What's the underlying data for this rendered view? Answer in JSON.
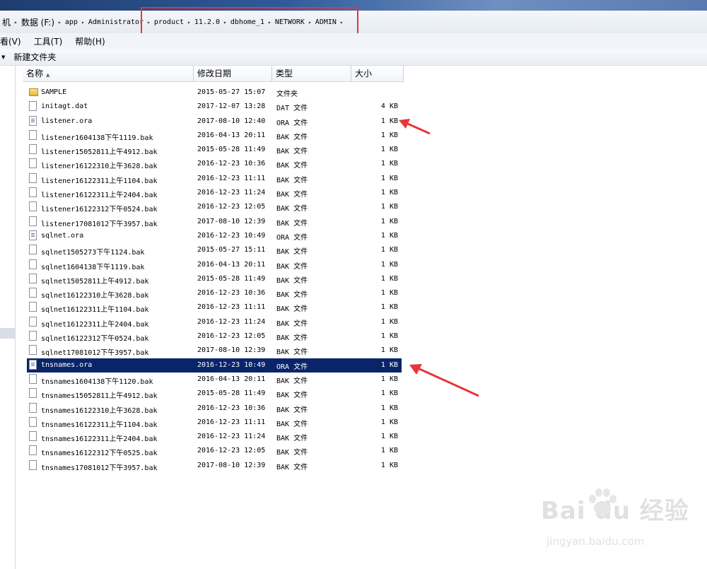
{
  "address": {
    "crumbs": [
      "机",
      "数据 (F:)",
      "app",
      "Administrator",
      "product",
      "11.2.0",
      "dbhome_1",
      "NETWORK",
      "ADMIN"
    ]
  },
  "menu": {
    "items": [
      "看(V)",
      "工具(T)",
      "帮助(H)"
    ]
  },
  "toolbar": {
    "new_folder": "新建文件夹"
  },
  "columns": {
    "name": "名称",
    "date": "修改日期",
    "type": "类型",
    "size": "大小"
  },
  "files": [
    {
      "name": "SAMPLE",
      "date": "2015-05-27 15:07",
      "type": "文件夹",
      "size": "",
      "icon": "folder-icon",
      "kind": "folder"
    },
    {
      "name": "initagt.dat",
      "date": "2017-12-07 13:28",
      "type": "DAT 文件",
      "size": "4 KB",
      "icon": "file-icon",
      "kind": "file"
    },
    {
      "name": "listener.ora",
      "date": "2017-08-10 12:40",
      "type": "ORA 文件",
      "size": "1 KB",
      "icon": "ora-file-icon",
      "kind": "ora"
    },
    {
      "name": "listener1604138下午1119.bak",
      "date": "2016-04-13 20:11",
      "type": "BAK 文件",
      "size": "1 KB",
      "icon": "file-icon",
      "kind": "file"
    },
    {
      "name": "listener15052811上午4912.bak",
      "date": "2015-05-28 11:49",
      "type": "BAK 文件",
      "size": "1 KB",
      "icon": "file-icon",
      "kind": "file"
    },
    {
      "name": "listener16122310上午3628.bak",
      "date": "2016-12-23 10:36",
      "type": "BAK 文件",
      "size": "1 KB",
      "icon": "file-icon",
      "kind": "file"
    },
    {
      "name": "listener16122311上午1104.bak",
      "date": "2016-12-23 11:11",
      "type": "BAK 文件",
      "size": "1 KB",
      "icon": "file-icon",
      "kind": "file"
    },
    {
      "name": "listener16122311上午2404.bak",
      "date": "2016-12-23 11:24",
      "type": "BAK 文件",
      "size": "1 KB",
      "icon": "file-icon",
      "kind": "file"
    },
    {
      "name": "listener16122312下午0524.bak",
      "date": "2016-12-23 12:05",
      "type": "BAK 文件",
      "size": "1 KB",
      "icon": "file-icon",
      "kind": "file"
    },
    {
      "name": "listener17081012下午3957.bak",
      "date": "2017-08-10 12:39",
      "type": "BAK 文件",
      "size": "1 KB",
      "icon": "file-icon",
      "kind": "file"
    },
    {
      "name": "sqlnet.ora",
      "date": "2016-12-23 10:49",
      "type": "ORA 文件",
      "size": "1 KB",
      "icon": "ora-file-icon",
      "kind": "ora"
    },
    {
      "name": "sqlnet1505273下午1124.bak",
      "date": "2015-05-27 15:11",
      "type": "BAK 文件",
      "size": "1 KB",
      "icon": "file-icon",
      "kind": "file"
    },
    {
      "name": "sqlnet1604138下午1119.bak",
      "date": "2016-04-13 20:11",
      "type": "BAK 文件",
      "size": "1 KB",
      "icon": "file-icon",
      "kind": "file"
    },
    {
      "name": "sqlnet15052811上午4912.bak",
      "date": "2015-05-28 11:49",
      "type": "BAK 文件",
      "size": "1 KB",
      "icon": "file-icon",
      "kind": "file"
    },
    {
      "name": "sqlnet16122310上午3628.bak",
      "date": "2016-12-23 10:36",
      "type": "BAK 文件",
      "size": "1 KB",
      "icon": "file-icon",
      "kind": "file"
    },
    {
      "name": "sqlnet16122311上午1104.bak",
      "date": "2016-12-23 11:11",
      "type": "BAK 文件",
      "size": "1 KB",
      "icon": "file-icon",
      "kind": "file"
    },
    {
      "name": "sqlnet16122311上午2404.bak",
      "date": "2016-12-23 11:24",
      "type": "BAK 文件",
      "size": "1 KB",
      "icon": "file-icon",
      "kind": "file"
    },
    {
      "name": "sqlnet16122312下午0524.bak",
      "date": "2016-12-23 12:05",
      "type": "BAK 文件",
      "size": "1 KB",
      "icon": "file-icon",
      "kind": "file"
    },
    {
      "name": "sqlnet17081012下午3957.bak",
      "date": "2017-08-10 12:39",
      "type": "BAK 文件",
      "size": "1 KB",
      "icon": "file-icon",
      "kind": "file"
    },
    {
      "name": "tnsnames.ora",
      "date": "2016-12-23 10:49",
      "type": "ORA 文件",
      "size": "1 KB",
      "icon": "ora-file-icon",
      "kind": "ora",
      "selected": true
    },
    {
      "name": "tnsnames1604138下午1120.bak",
      "date": "2016-04-13 20:11",
      "type": "BAK 文件",
      "size": "1 KB",
      "icon": "file-icon",
      "kind": "file"
    },
    {
      "name": "tnsnames15052811上午4912.bak",
      "date": "2015-05-28 11:49",
      "type": "BAK 文件",
      "size": "1 KB",
      "icon": "file-icon",
      "kind": "file"
    },
    {
      "name": "tnsnames16122310上午3628.bak",
      "date": "2016-12-23 10:36",
      "type": "BAK 文件",
      "size": "1 KB",
      "icon": "file-icon",
      "kind": "file"
    },
    {
      "name": "tnsnames16122311上午1104.bak",
      "date": "2016-12-23 11:11",
      "type": "BAK 文件",
      "size": "1 KB",
      "icon": "file-icon",
      "kind": "file"
    },
    {
      "name": "tnsnames16122311上午2404.bak",
      "date": "2016-12-23 11:24",
      "type": "BAK 文件",
      "size": "1 KB",
      "icon": "file-icon",
      "kind": "file"
    },
    {
      "name": "tnsnames16122312下午0525.bak",
      "date": "2016-12-23 12:05",
      "type": "BAK 文件",
      "size": "1 KB",
      "icon": "file-icon",
      "kind": "file"
    },
    {
      "name": "tnsnames17081012下午3957.bak",
      "date": "2017-08-10 12:39",
      "type": "BAK 文件",
      "size": "1 KB",
      "icon": "file-icon",
      "kind": "file"
    }
  ],
  "colors": {
    "selection": "#0a246a",
    "annotation": "#e8353a",
    "watermark": "#e1e1e1"
  },
  "watermark": {
    "logo_text": "Bai du 经验",
    "url": "jingyan.baidu.com"
  }
}
